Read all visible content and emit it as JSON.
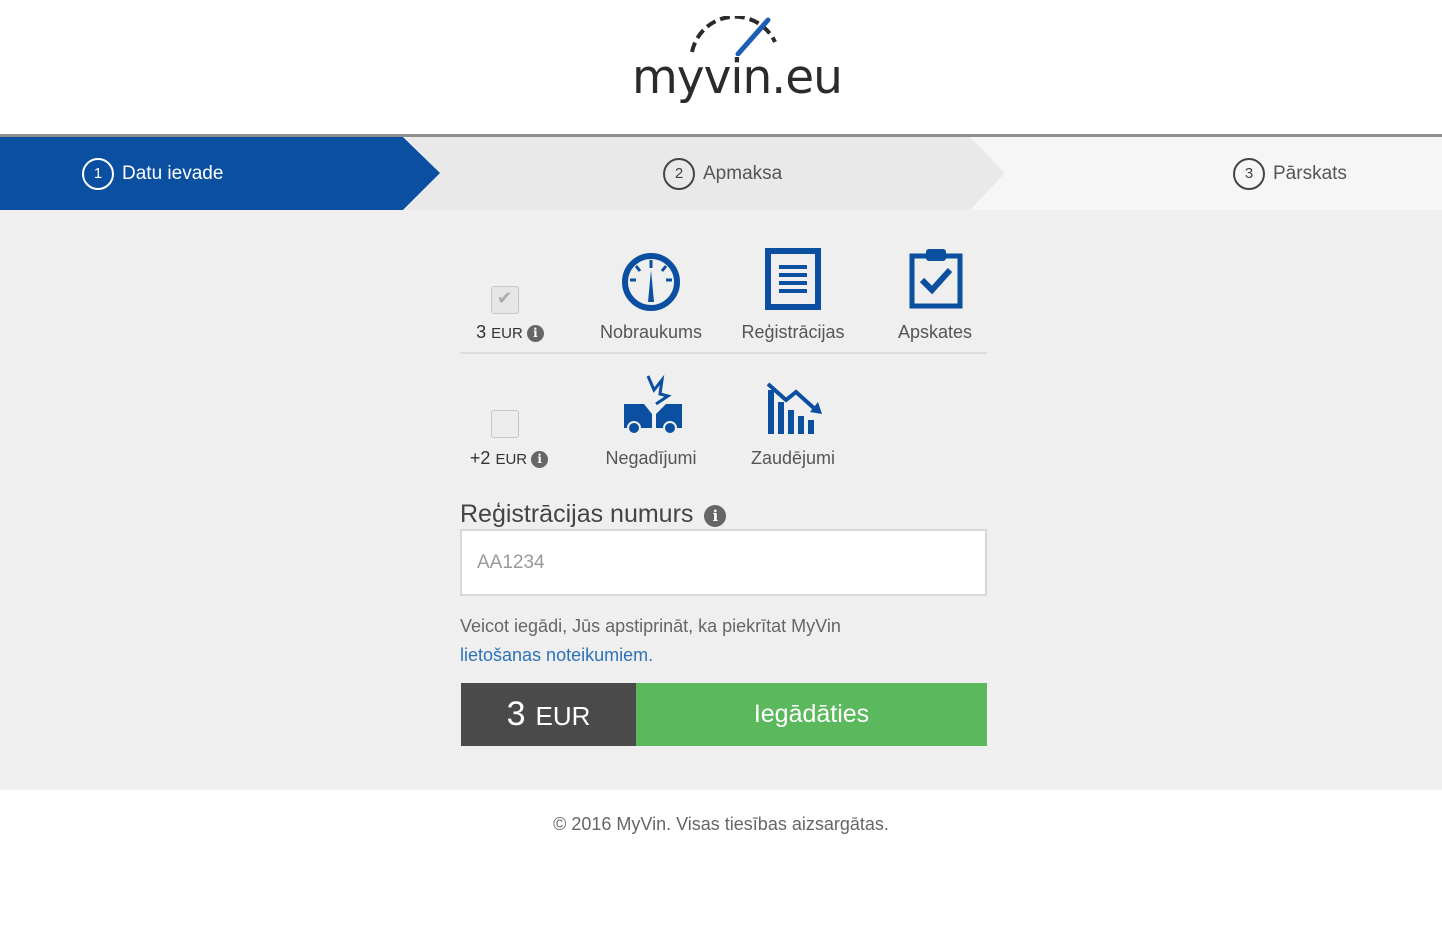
{
  "brand": {
    "logo_text": "myvin.eu",
    "accent_color": "#0a4fa0",
    "buy_color": "#5cb85c"
  },
  "steps": [
    {
      "number": "1",
      "label": "Datu ievade",
      "active": true
    },
    {
      "number": "2",
      "label": "Apmaksa",
      "active": false
    },
    {
      "number": "3",
      "label": "Pārskats",
      "active": false
    }
  ],
  "packages": {
    "basic": {
      "price_value": "3",
      "price_currency": "EUR",
      "checked": true,
      "disabled": true,
      "items": [
        {
          "label": "Nobraukums",
          "icon": "speedometer-icon"
        },
        {
          "label": "Reģistrācijas",
          "icon": "document-icon"
        },
        {
          "label": "Apskates",
          "icon": "clipboard-check-icon"
        }
      ]
    },
    "extra": {
      "price_value": "+2",
      "price_currency": "EUR",
      "checked": false,
      "items": [
        {
          "label": "Negadījumi",
          "icon": "car-crash-icon"
        },
        {
          "label": "Zaudējumi",
          "icon": "chart-decline-icon"
        }
      ]
    }
  },
  "registration": {
    "label": "Reģistrācijas numurs",
    "placeholder": "AA1234",
    "value": ""
  },
  "terms": {
    "text": "Veicot iegādi, Jūs apstiprināt, ka piekrītat MyVin",
    "link_text": "lietošanas noteikumiem."
  },
  "purchase": {
    "price_value": "3",
    "price_currency": "EUR",
    "button_label": "Iegādāties"
  },
  "footer": {
    "copyright": "© 2016 MyVin. Visas tiesības aizsargātas."
  }
}
